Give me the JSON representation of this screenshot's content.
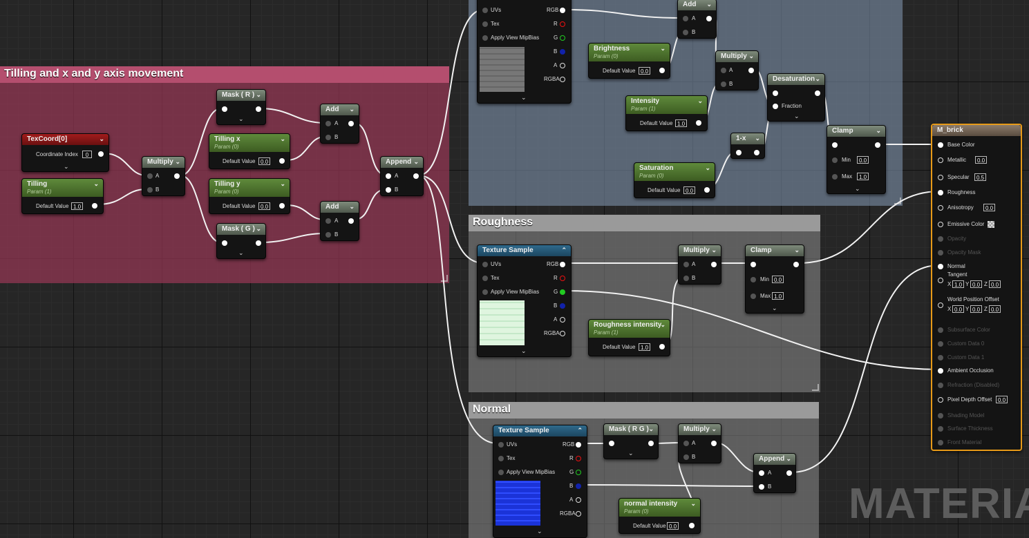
{
  "comments": {
    "tiling": "Tilling and x and y axis movement",
    "roughness": "Roughness",
    "normal": "Normal"
  },
  "labels": {
    "texcoord_title": "TexCoord[0]",
    "coordinate_index": "Coordinate Index",
    "default_value": "Default Value",
    "multiply": "Multiply",
    "add": "Add",
    "append": "Append",
    "mask_r": "Mask ( R )",
    "mask_g": "Mask ( G )",
    "mask_rg": "Mask ( R G )",
    "desaturation": "Desaturation",
    "fraction": "Fraction",
    "one_minus": "1-x",
    "clamp": "Clamp",
    "min": "Min",
    "max": "Max",
    "texture_sample": "Texture Sample",
    "pin_a": "A",
    "pin_b": "B",
    "pin_uvs": "UVs",
    "pin_tex": "Tex",
    "pin_mip": "Apply View MipBias",
    "pin_rgb": "RGB",
    "pin_r": "R",
    "pin_g": "G",
    "pin_bb": "B",
    "pin_aa": "A",
    "pin_rgba": "RGBA",
    "watermark": "MATERIAL"
  },
  "params": {
    "tilling": {
      "name": "Tilling",
      "sub": "Param (1)",
      "value": "1.0"
    },
    "tilling_x": {
      "name": "Tilling x",
      "sub": "Param (0)",
      "value": "0.0"
    },
    "tilling_y": {
      "name": "Tilling y",
      "sub": "Param (0)",
      "value": "0.0"
    },
    "brightness": {
      "name": "Brightness",
      "sub": "Param (0)",
      "value": "0.0"
    },
    "intensity": {
      "name": "Intensity",
      "sub": "Param (1)",
      "value": "1.0"
    },
    "saturation": {
      "name": "Saturation",
      "sub": "Param (0)",
      "value": "0.0"
    },
    "roughness_intensity": {
      "name": "Roughness intensity",
      "sub": "Param (1)",
      "value": "1.0"
    },
    "normal_intensity": {
      "name": "normal intensity",
      "sub": "Param (0)",
      "value": "0.0"
    }
  },
  "values": {
    "coord_index": "0",
    "clamp1_min": "0.0",
    "clamp1_max": "1.0",
    "clamp2_min": "0.0",
    "clamp2_max": "1.0"
  },
  "material": {
    "title": "M_brick",
    "inputs": [
      {
        "label": "Base Color",
        "active": true
      },
      {
        "label": "Metallic",
        "active": true,
        "value": "0.0"
      },
      {
        "label": "Specular",
        "active": true,
        "value": "0.5"
      },
      {
        "label": "Roughness",
        "active": true
      },
      {
        "label": "Anisotropy",
        "active": true,
        "value": "0.0"
      },
      {
        "label": "Emissive Color",
        "active": true
      },
      {
        "label": "Opacity",
        "active": false
      },
      {
        "label": "Opacity Mask",
        "active": false
      },
      {
        "label": "Normal",
        "active": true
      },
      {
        "label": "Tangent",
        "active": true
      },
      {
        "label": "World Position Offset",
        "active": true
      },
      {
        "label": "Subsurface Color",
        "active": false
      },
      {
        "label": "Custom Data 0",
        "active": false
      },
      {
        "label": "Custom Data 1",
        "active": false
      },
      {
        "label": "Ambient Occlusion",
        "active": true
      },
      {
        "label": "Refraction (Disabled)",
        "active": false
      },
      {
        "label": "Pixel Depth Offset",
        "active": true,
        "value": "0.0"
      },
      {
        "label": "Shading Model",
        "active": false
      },
      {
        "label": "Surface Thickness",
        "active": false
      },
      {
        "label": "Front Material",
        "active": false
      }
    ],
    "tangent": {
      "x": "1.0",
      "y": "0.0",
      "z": "0.0"
    },
    "wpo": {
      "x": "0.0",
      "y": "0.0",
      "z": "0.0"
    },
    "axis_x": "X",
    "axis_y": "Y",
    "axis_z": "Z"
  },
  "colors": {
    "comment_tiling": "#b44e6e",
    "comment_color_adjust": "#7d91aa",
    "comment_gray": "#9a9a9a",
    "param_header": "#5f8a3b",
    "texture_header": "#2f6a8c",
    "material_border": "#e79a18"
  }
}
